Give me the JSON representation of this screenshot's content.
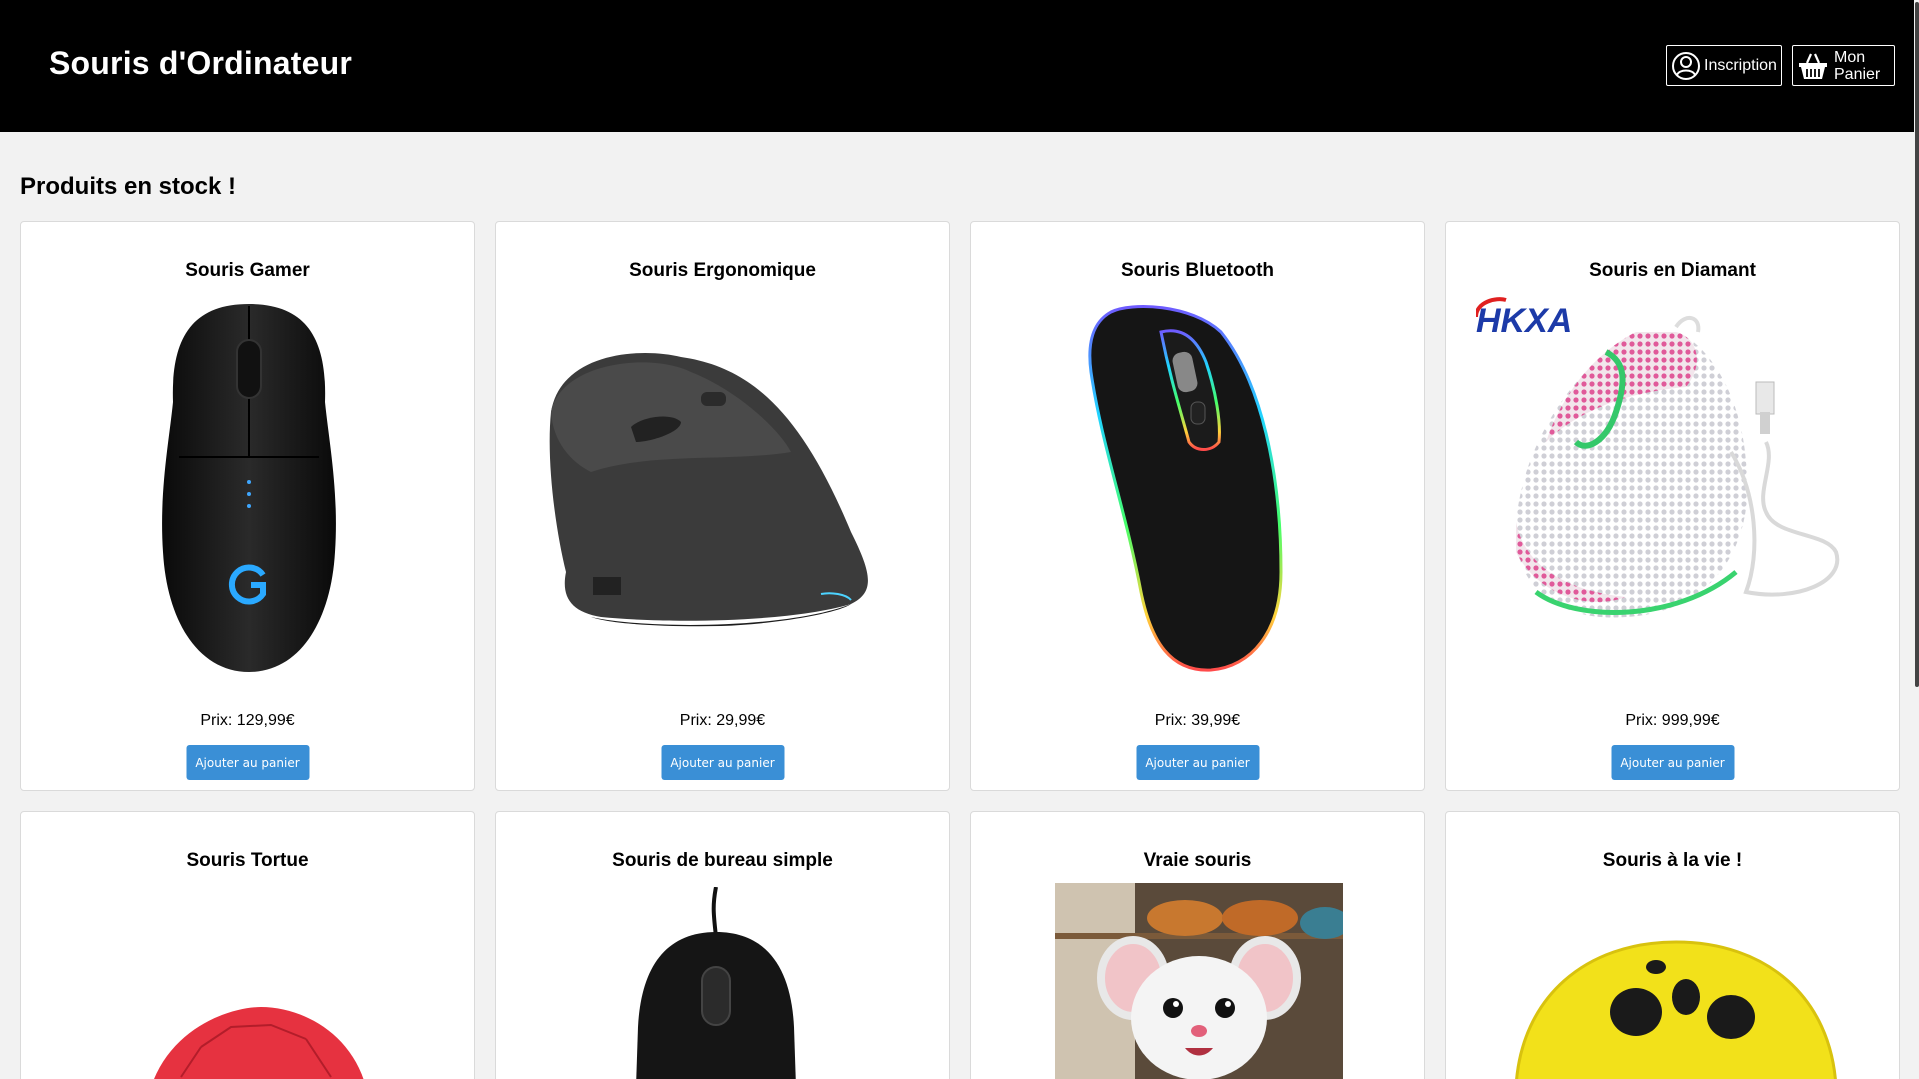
{
  "header": {
    "title": "Souris d'Ordinateur",
    "inscription_label": "Inscription",
    "panier_line1": "Mon",
    "panier_line2": "Panier"
  },
  "section_title": "Produits en stock !",
  "products": [
    {
      "name": "Souris Gamer",
      "price": "Prix: 129,99€",
      "button": "Ajouter au panier"
    },
    {
      "name": "Souris Ergonomique",
      "price": "Prix: 29,99€",
      "button": "Ajouter au panier"
    },
    {
      "name": "Souris Bluetooth",
      "price": "Prix: 39,99€",
      "button": "Ajouter au panier"
    },
    {
      "name": "Souris en Diamant",
      "price": "Prix: 999,99€",
      "button": "Ajouter au panier",
      "brand_logo": "HKXA"
    },
    {
      "name": "Souris Tortue"
    },
    {
      "name": "Souris de bureau simple"
    },
    {
      "name": "Vraie souris"
    },
    {
      "name": "Souris à la vie !"
    }
  ],
  "colors": {
    "header_bg": "#000000",
    "page_bg": "#f2f2f2",
    "button_blue": "#3a8fd6"
  },
  "icons": [
    "user-icon",
    "basket-icon"
  ]
}
